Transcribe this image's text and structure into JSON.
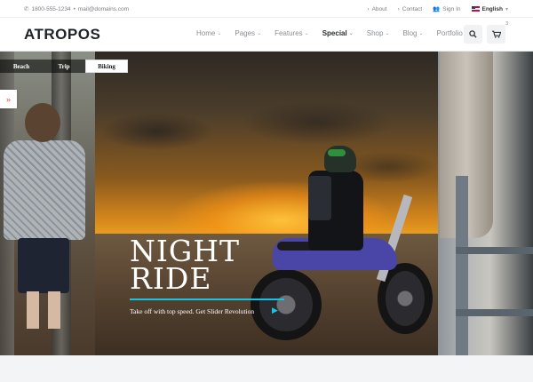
{
  "topbar": {
    "phone": "1800-555-1234",
    "separator": "•",
    "email": "mail@domains.com",
    "links": [
      "About",
      "Contact",
      "Sign In"
    ],
    "language": "English"
  },
  "header": {
    "logo": "ATROPOS",
    "nav": [
      {
        "label": "Home",
        "active": false
      },
      {
        "label": "Pages",
        "active": false
      },
      {
        "label": "Features",
        "active": false
      },
      {
        "label": "Special",
        "active": true
      },
      {
        "label": "Shop",
        "active": false
      },
      {
        "label": "Blog",
        "active": false
      },
      {
        "label": "Portfolio",
        "active": false
      }
    ],
    "cart_count": "3"
  },
  "slider": {
    "tabs": [
      "Beach",
      "Trip",
      "Biking"
    ],
    "active_tab": "Biking",
    "title_line1": "NIGHT",
    "title_line2": "RIDE",
    "subtitle": "Take off with top speed. Get Slider Revolution",
    "accent_color": "#18c4e6"
  }
}
